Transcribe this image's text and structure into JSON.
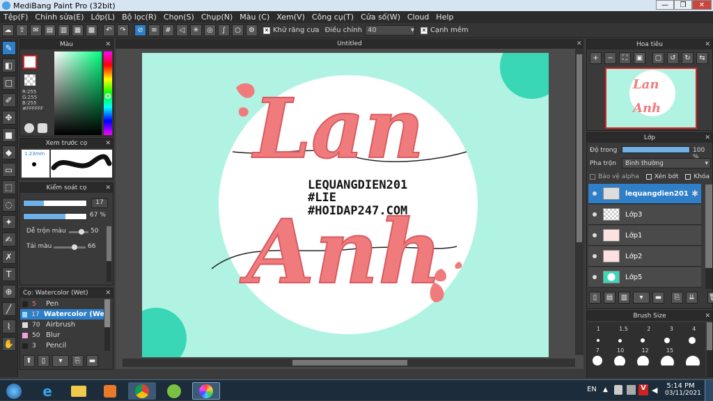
{
  "window": {
    "title": "MediBang Paint Pro (32bit)"
  },
  "menu": [
    "Tệp(F)",
    "Chỉnh sửa(E)",
    "Lớp(L)",
    "Bộ lọc(R)",
    "Chọn(S)",
    "Chụp(N)",
    "Màu (C)",
    "Xem(V)",
    "Công cụ(T)",
    "Cửa số(W)",
    "Cloud",
    "Help"
  ],
  "toolbar": {
    "antialias_label": "Khử răng cưa",
    "adjust_label": "Điều chỉnh",
    "adjust_value": "40",
    "edge_label": "Cạnh mềm"
  },
  "color_panel": {
    "title": "Màu",
    "r": "R:255",
    "g": "G:255",
    "b": "B:255",
    "hex": "#FFFFFF"
  },
  "brush_preview": {
    "title": "Xem trước cọ",
    "size": "1.23mm"
  },
  "brush_control": {
    "title": "Kiểm soát cọ",
    "size_value": "17",
    "opacity_value": "67 %",
    "mix_label": "Dễ trộn màu",
    "mix_value": "50",
    "load_label": "Tải màu",
    "load_value": "66"
  },
  "brush_list": {
    "title": "Cọ: Watercolor (Wet)",
    "items": [
      {
        "size": "5",
        "name": "Pen"
      },
      {
        "size": "17",
        "name": "Watercolor (Wet)"
      },
      {
        "size": "70",
        "name": "Airbrush"
      },
      {
        "size": "50",
        "name": "Blur"
      },
      {
        "size": "3",
        "name": "Pencil"
      }
    ]
  },
  "canvas": {
    "tab_title": "Untitled",
    "text_line1": "LEQUANGDIEN201",
    "text_line2": "#LIE",
    "text_line3": "#HOIDAP247.COM",
    "title_top": "Lan",
    "title_bottom": "Anh"
  },
  "navigator": {
    "title": "Hoa tiêu"
  },
  "layers": {
    "title": "Lớp",
    "opacity_label": "Độ trong",
    "opacity_value": "100 %",
    "blend_label": "Pha trộn",
    "blend_value": "Bình thường",
    "protect_label": "Bảo vệ alpha",
    "clip_label": "Xén bớt",
    "lock_label": "Khóa",
    "items": [
      {
        "name": "lequangdien201"
      },
      {
        "name": "Lớp3"
      },
      {
        "name": "Lớp1"
      },
      {
        "name": "Lớp2"
      },
      {
        "name": "Lớp5"
      }
    ]
  },
  "brush_size": {
    "title": "Brush Size",
    "row1": [
      "1",
      "1.5",
      "2",
      "3",
      "4"
    ],
    "row2": [
      "7",
      "10",
      "12",
      "15"
    ]
  },
  "taskbar": {
    "lang": "EN",
    "time": "5:14 PM",
    "date": "03/11/2021"
  },
  "colors": {
    "accent": "#2e7fc7",
    "canvas_bg": "#b1f3e3",
    "letters": "#f07b7d"
  }
}
